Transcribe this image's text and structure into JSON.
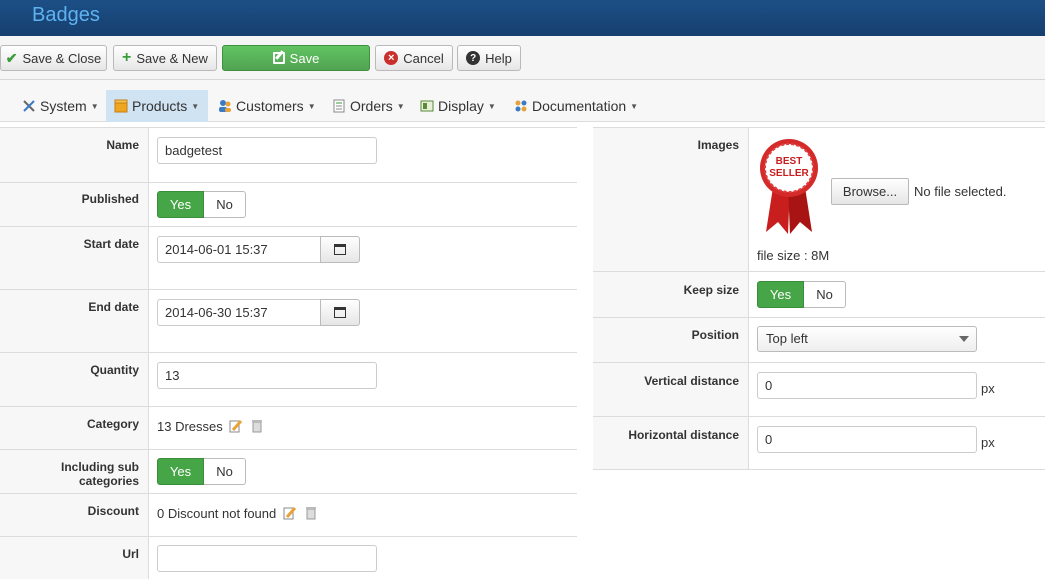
{
  "header": {
    "title": "Badges"
  },
  "toolbar": {
    "save_close": "Save & Close",
    "save_new": "Save & New",
    "save": "Save",
    "cancel": "Cancel",
    "help": "Help"
  },
  "menu": {
    "system": "System",
    "products": "Products",
    "customers": "Customers",
    "orders": "Orders",
    "display": "Display",
    "documentation": "Documentation"
  },
  "form": {
    "name": {
      "label": "Name",
      "value": "badgetest"
    },
    "published": {
      "label": "Published",
      "yes": "Yes",
      "no": "No",
      "selected": "Yes"
    },
    "start_date": {
      "label": "Start date",
      "value": "2014-06-01 15:37"
    },
    "end_date": {
      "label": "End date",
      "value": "2014-06-30 15:37"
    },
    "quantity": {
      "label": "Quantity",
      "value": "13"
    },
    "category": {
      "label": "Category",
      "value": "13 Dresses"
    },
    "sub_categories": {
      "label": "Including sub categories",
      "yes": "Yes",
      "no": "No",
      "selected": "Yes"
    },
    "discount": {
      "label": "Discount",
      "value": "0 Discount not found"
    },
    "url": {
      "label": "Url",
      "value": ""
    }
  },
  "right": {
    "images": {
      "label": "Images",
      "badge_line1": "BEST",
      "badge_line2": "SELLER",
      "browse": "Browse...",
      "no_file": "No file selected.",
      "file_size": "file size : 8M"
    },
    "keep_size": {
      "label": "Keep size",
      "yes": "Yes",
      "no": "No",
      "selected": "Yes"
    },
    "position": {
      "label": "Position",
      "value": "Top left"
    },
    "vertical": {
      "label": "Vertical distance",
      "value": "0",
      "unit": "px"
    },
    "horizontal": {
      "label": "Horizontal distance",
      "value": "0",
      "unit": "px"
    }
  },
  "colors": {
    "accent_green": "#46a546",
    "header_blue": "#1c4f86",
    "title_blue": "#5fb2f0"
  }
}
